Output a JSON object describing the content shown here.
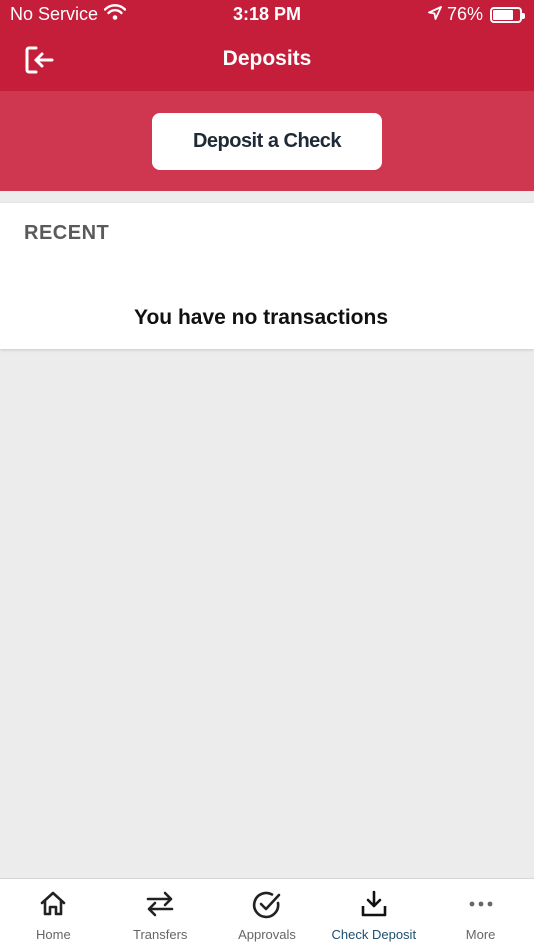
{
  "status_bar": {
    "carrier": "No Service",
    "time": "3:18 PM",
    "battery_text": "76%",
    "battery_level": 0.76
  },
  "header": {
    "title": "Deposits",
    "logout_icon": "logout-icon"
  },
  "actions": {
    "deposit_button_label": "Deposit a Check"
  },
  "recent": {
    "heading": "RECENT",
    "empty_message": "You have no transactions"
  },
  "tab_bar": {
    "active_index": 3,
    "accent_color": "#1d4f6e",
    "tabs": [
      {
        "label": "Home",
        "icon": "home-icon"
      },
      {
        "label": "Transfers",
        "icon": "transfer-arrows-icon"
      },
      {
        "label": "Approvals",
        "icon": "check-circle-icon"
      },
      {
        "label": "Check Deposit",
        "icon": "download-tray-icon"
      },
      {
        "label": "More",
        "icon": "more-dots-icon"
      }
    ]
  },
  "colors": {
    "brand_red": "#c41e3a",
    "band_red": "#cf3650",
    "background": "#ececec"
  }
}
